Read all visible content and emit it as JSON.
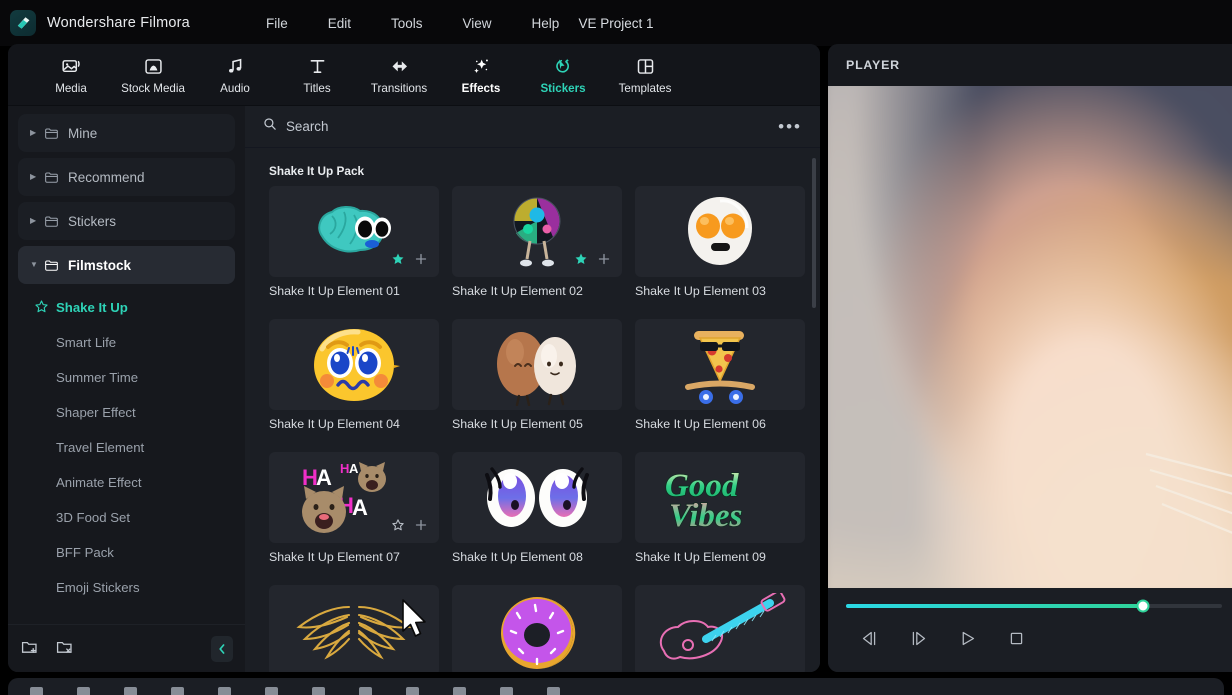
{
  "app": {
    "brand": "Wondershare Filmora",
    "logo_icon": "filmora-rhombus-logo",
    "project_title": "VE Project 1",
    "accent_color": "#2ed3b7"
  },
  "menubar": {
    "items": [
      {
        "label": "File"
      },
      {
        "label": "Edit"
      },
      {
        "label": "Tools"
      },
      {
        "label": "View"
      },
      {
        "label": "Help"
      }
    ]
  },
  "tabs": [
    {
      "label": "Media",
      "icon": "media-image-icon",
      "active": false
    },
    {
      "label": "Stock Media",
      "icon": "stock-media-icon",
      "active": false
    },
    {
      "label": "Audio",
      "icon": "music-note-icon",
      "active": false
    },
    {
      "label": "Titles",
      "icon": "text-t-icon",
      "active": false
    },
    {
      "label": "Transitions",
      "icon": "transitions-arrow-icon",
      "active": false
    },
    {
      "label": "Effects",
      "icon": "effects-wand-icon",
      "active": false
    },
    {
      "label": "Stickers",
      "icon": "stickers-cursor-icon",
      "active": true
    },
    {
      "label": "Templates",
      "icon": "templates-layout-icon",
      "active": false
    }
  ],
  "sidebar": {
    "folders": [
      {
        "label": "Mine",
        "selected": false,
        "expanded": false
      },
      {
        "label": "Recommend",
        "selected": false,
        "expanded": false
      },
      {
        "label": "Stickers",
        "selected": false,
        "expanded": false
      },
      {
        "label": "Filmstock",
        "selected": true,
        "expanded": true
      }
    ],
    "sub_items": [
      {
        "label": "Shake It Up",
        "selected": true
      },
      {
        "label": "Smart Life",
        "selected": false
      },
      {
        "label": "Summer Time",
        "selected": false
      },
      {
        "label": "Shaper Effect",
        "selected": false
      },
      {
        "label": "Travel Element",
        "selected": false
      },
      {
        "label": "Animate Effect",
        "selected": false
      },
      {
        "label": "3D Food Set",
        "selected": false
      },
      {
        "label": "BFF Pack",
        "selected": false
      },
      {
        "label": "Emoji Stickers",
        "selected": false
      }
    ],
    "footer": {
      "new_folder_icon": "new-folder-icon",
      "delete_folder_icon": "delete-folder-icon",
      "collapse_icon": "chevron-left-icon"
    }
  },
  "search": {
    "placeholder": "Search",
    "icon": "search-icon",
    "more_icon": "more-options-icon"
  },
  "library": {
    "pack_title": "Shake It Up Pack",
    "items": [
      {
        "label": "Shake It Up Element 01",
        "art": "brain",
        "favorite": true,
        "hover": true
      },
      {
        "label": "Shake It Up Element 02",
        "art": "disco-ball",
        "favorite": true,
        "hover": true
      },
      {
        "label": "Shake It Up Element 03",
        "art": "fried-egg",
        "favorite": false,
        "hover": false
      },
      {
        "label": "Shake It Up Element 04",
        "art": "lemon-face",
        "favorite": false,
        "hover": false
      },
      {
        "label": "Shake It Up Element 05",
        "art": "two-eggs",
        "favorite": false,
        "hover": false
      },
      {
        "label": "Shake It Up Element 06",
        "art": "pizza-skateboard",
        "favorite": false,
        "hover": false
      },
      {
        "label": "Shake It Up Element 07",
        "art": "laughing-cats",
        "favorite": false,
        "hover": true
      },
      {
        "label": "Shake It Up Element 08",
        "art": "cartoon-eyes",
        "favorite": false,
        "hover": false
      },
      {
        "label": "Shake It Up Element 09",
        "art": "good-vibes-text",
        "favorite": false,
        "hover": false
      },
      {
        "label": "",
        "art": "golden-wings",
        "favorite": false,
        "hover": false
      },
      {
        "label": "",
        "art": "purple-donut",
        "favorite": false,
        "hover": false
      },
      {
        "label": "",
        "art": "neon-guitar",
        "favorite": false,
        "hover": false
      }
    ],
    "overlay_icons": {
      "favorite": "star-icon",
      "add": "plus-icon"
    }
  },
  "player": {
    "title": "PLAYER",
    "progress_percent": 74,
    "controls": [
      {
        "name": "previous-frame",
        "icon": "prev-frame-icon"
      },
      {
        "name": "next-frame",
        "icon": "next-frame-icon"
      },
      {
        "name": "play",
        "icon": "play-icon"
      },
      {
        "name": "stop",
        "icon": "stop-icon"
      }
    ]
  }
}
